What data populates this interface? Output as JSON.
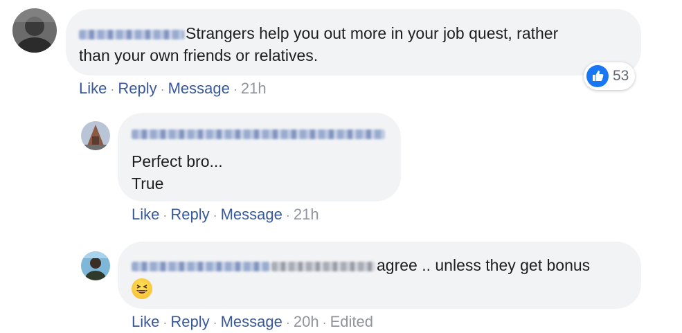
{
  "comments": [
    {
      "text_line1": "Strangers help you out more in your job quest, rather",
      "text_line2": "than your own friends or relatives.",
      "reaction_count": "53",
      "actions": {
        "like": "Like",
        "reply": "Reply",
        "message": "Message",
        "time": "21h"
      }
    },
    {
      "text_line1": "Perfect bro...",
      "text_line2": "True",
      "actions": {
        "like": "Like",
        "reply": "Reply",
        "message": "Message",
        "time": "21h"
      }
    },
    {
      "text_line1": "agree .. unless they get bonus",
      "emoji": "grinning-squinting-face-emoji",
      "actions": {
        "like": "Like",
        "reply": "Reply",
        "message": "Message",
        "time": "20h",
        "edited": "Edited"
      }
    }
  ],
  "colors": {
    "bubble": "#f2f3f5",
    "link": "#385898",
    "meta": "#90949c",
    "like_blue": "#1877f2"
  },
  "icons": [
    "avatar-icon",
    "thumbs-up-icon",
    "emoji-icon"
  ]
}
